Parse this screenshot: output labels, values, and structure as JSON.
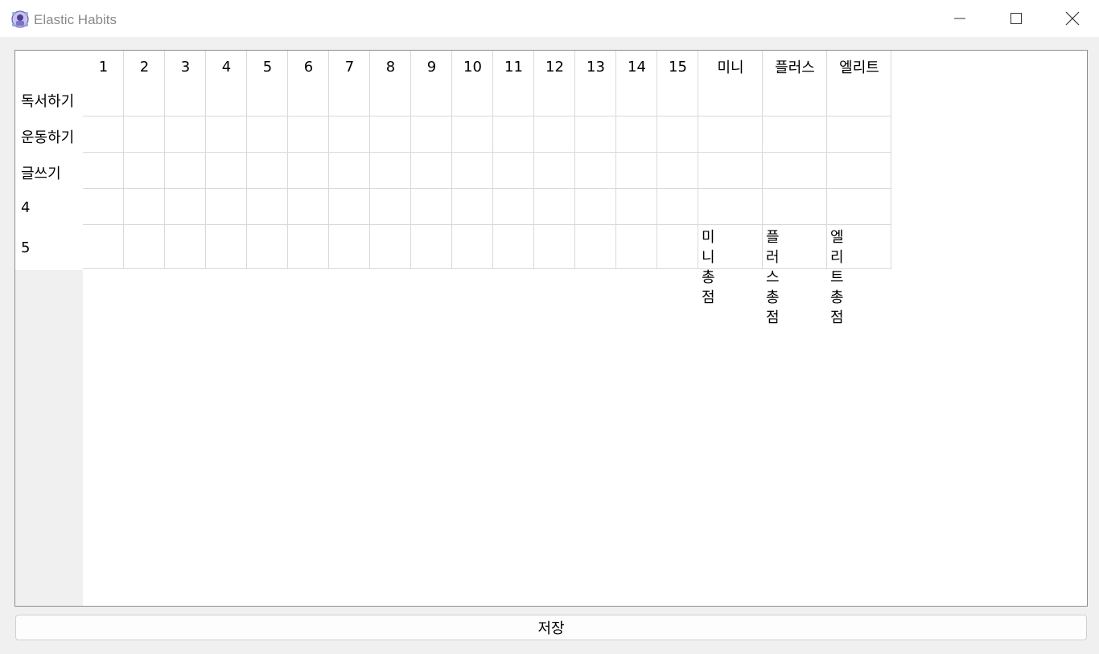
{
  "window": {
    "title": "Elastic Habits",
    "app_icon": "app-logo-icon",
    "controls": [
      "minimize-icon",
      "maximize-icon",
      "close-icon"
    ]
  },
  "table": {
    "columns": [
      "1",
      "2",
      "3",
      "4",
      "5",
      "6",
      "7",
      "8",
      "9",
      "10",
      "11",
      "12",
      "13",
      "14",
      "15",
      "미니",
      "플러스",
      "엘리트"
    ],
    "rows": [
      "독서하기",
      "운동하기",
      "글쓰기",
      "4",
      "5"
    ],
    "totals": {
      "mini_line1": "미니",
      "mini_line2": "총점",
      "plus_line1": "플러스",
      "plus_line2": "총점",
      "elite_line1": "엘리트",
      "elite_line2": "총점"
    }
  },
  "footer": {
    "save_label": "저장"
  },
  "colors": {
    "grid_line": "#d9d9d9",
    "panel_border": "#8c8c8c",
    "background": "#f0f0f0"
  }
}
